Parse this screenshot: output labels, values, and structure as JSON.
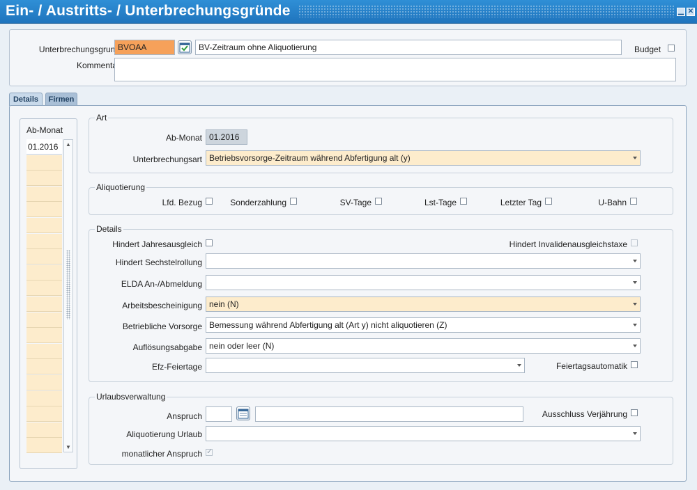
{
  "window": {
    "title": "Ein- / Austritts- / Unterbrechungsgründe",
    "minimize_icon": "minimize-icon",
    "close_icon": "close-icon"
  },
  "header": {
    "unterbrechungsgrund_label": "Unterbrechungsgrund",
    "code_value": "BVOAA",
    "description_value": "BV-Zeitraum ohne Aliquotierung",
    "budget_label": "Budget",
    "budget_checked": false,
    "kommentar_label": "Kommentar",
    "kommentar_value": ""
  },
  "tabs": [
    {
      "label": "Details",
      "active": true
    },
    {
      "label": "Firmen",
      "active": false
    }
  ],
  "month_list": {
    "header": "Ab-Monat",
    "items": [
      "01.2016",
      "",
      "",
      "",
      "",
      "",
      "",
      "",
      "",
      "",
      "",
      "",
      "",
      "",
      "",
      "",
      "",
      "",
      "",
      ""
    ]
  },
  "art": {
    "title": "Art",
    "ab_monat_label": "Ab-Monat",
    "ab_monat_value": "01.2016",
    "unterbrechungsart_label": "Unterbrechungsart",
    "unterbrechungsart_value": "Betriebsvorsorge-Zeitraum während Abfertigung alt (y)"
  },
  "aliquotierung": {
    "title": "Aliquotierung",
    "items": [
      {
        "label": "Lfd. Bezug",
        "checked": false
      },
      {
        "label": "Sonderzahlung",
        "checked": false
      },
      {
        "label": "SV-Tage",
        "checked": false
      },
      {
        "label": "Lst-Tage",
        "checked": false
      },
      {
        "label": "Letzter Tag",
        "checked": false
      },
      {
        "label": "U-Bahn",
        "checked": false
      }
    ]
  },
  "details": {
    "title": "Details",
    "hindert_jahresausgleich_label": "Hindert Jahresausgleich",
    "hindert_invaliden_label": "Hindert Invalidenausgleichstaxe",
    "hindert_sechstel_label": "Hindert Sechstelrollung",
    "hindert_sechstel_value": "",
    "elda_label": "ELDA An-/Abmeldung",
    "elda_value": "",
    "arbeitsbescheinigung_label": "Arbeitsbescheinigung",
    "arbeitsbescheinigung_value": "nein (N)",
    "betriebliche_vorsorge_label": "Betriebliche Vorsorge",
    "betriebliche_vorsorge_value": "Bemessung während Abfertigung alt (Art y) nicht aliquotieren (Z)",
    "aufloesungsabgabe_label": "Auflösungsabgabe",
    "aufloesungsabgabe_value": "nein oder leer (N)",
    "efz_feiertage_label": "Efz-Feiertage",
    "efz_feiertage_value": "",
    "feiertagsautomatik_label": "Feiertagsautomatik"
  },
  "urlaub": {
    "title": "Urlaubsverwaltung",
    "anspruch_label": "Anspruch",
    "anspruch_value": "",
    "anspruch_text": "",
    "ausschluss_label": "Ausschluss Verjährung",
    "aliquotierung_urlaub_label": "Aliquotierung Urlaub",
    "aliquotierung_urlaub_value": "",
    "monatlicher_anspruch_label": "monatlicher Anspruch",
    "monatlicher_anspruch_checked": true
  }
}
